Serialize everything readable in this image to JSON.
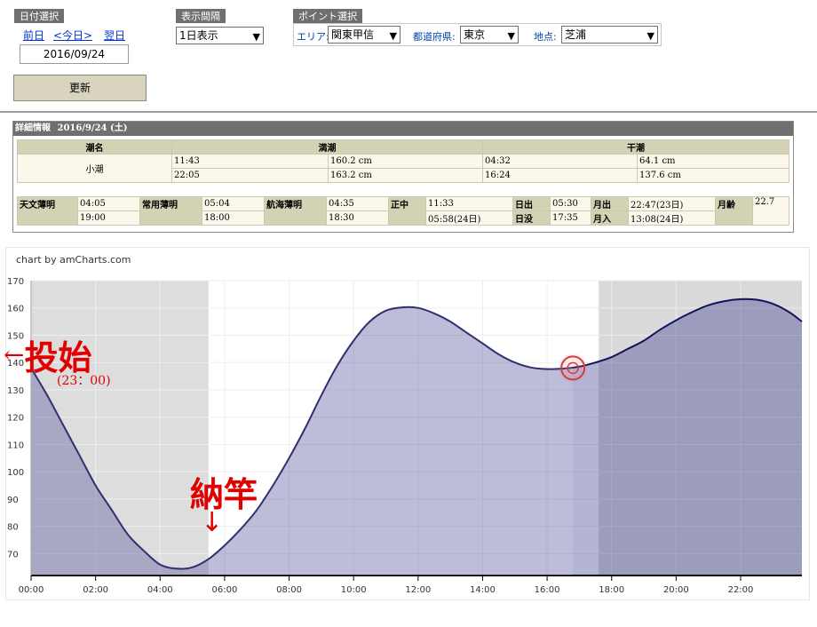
{
  "date_select": {
    "header": "日付選択",
    "prev": "前日",
    "today": "<今日>",
    "next": "翌日",
    "date_value": "2016/09/24"
  },
  "display_interval": {
    "header": "表示間隔",
    "selected": "1日表示"
  },
  "point_select": {
    "header": "ポイント選択",
    "area_label": "エリア:",
    "area_value": "関東甲信",
    "pref_label": "都道府県:",
    "pref_value": "東京",
    "spot_label": "地点:",
    "spot_value": "芝浦"
  },
  "update_button": "更新",
  "detail": {
    "header_title": "詳細情報",
    "header_date": "2016/9/24 (土)",
    "tide_name_header": "潮名",
    "high_header": "満潮",
    "low_header": "干潮",
    "tide_name": "小潮",
    "high": [
      {
        "time": "11:43",
        "height": "160.2 cm"
      },
      {
        "time": "22:05",
        "height": "163.2 cm"
      }
    ],
    "low": [
      {
        "time": "04:32",
        "height": "64.1 cm"
      },
      {
        "time": "16:24",
        "height": "137.6 cm"
      }
    ],
    "astro_label": "天文薄明",
    "astro_1": "04:05",
    "astro_2": "19:00",
    "civil_label": "常用薄明",
    "civil_1": "05:04",
    "civil_2": "18:00",
    "nautical_label": "航海薄明",
    "nautical_1": "04:35",
    "nautical_2": "18:30",
    "transit_label": "正中",
    "transit_1": "11:33",
    "transit_2": "05:58(24日)",
    "sunrise_label": "日出",
    "sunrise": "05:30",
    "sunset_label": "日没",
    "sunset": "17:35",
    "moonrise_label": "月出",
    "moonrise": "22:47(23日)",
    "moonset_label": "月入",
    "moonset": "13:08(24日)",
    "moonage_label": "月齢",
    "moonage": "22.7"
  },
  "annotations": {
    "start_text": "投始",
    "start_arrow": "←",
    "start_time": "(23：00)",
    "end_text": "納竿",
    "end_arrow": "↓"
  },
  "chart_data": {
    "type": "area",
    "credit": "chart by amCharts.com",
    "x_ticks": [
      "00:00",
      "02:00",
      "04:00",
      "06:00",
      "08:00",
      "10:00",
      "12:00",
      "14:00",
      "16:00",
      "18:00",
      "20:00",
      "22:00"
    ],
    "y_ticks": [
      70,
      80,
      90,
      100,
      110,
      120,
      130,
      140,
      150,
      160,
      170
    ],
    "ylim": [
      62,
      170
    ],
    "xlim_hours": [
      0,
      23.9
    ],
    "night_bands_hours": [
      [
        0,
        5.5
      ],
      [
        17.6,
        23.9
      ]
    ],
    "grid": true,
    "series": [
      {
        "x_hours": [
          0,
          0.5,
          1,
          1.5,
          2,
          2.5,
          3,
          3.5,
          4,
          4.5,
          5,
          5.5,
          6,
          6.5,
          7,
          7.5,
          8,
          8.5,
          9,
          9.5,
          10,
          10.5,
          11,
          11.5,
          12,
          12.5,
          13,
          13.5,
          14,
          14.5,
          15,
          15.5,
          16,
          16.5,
          17,
          17.5,
          18,
          18.5,
          19,
          19.5,
          20,
          20.5,
          21,
          21.5,
          22,
          22.5,
          23,
          23.5,
          23.9
        ],
        "values": [
          138,
          128,
          117,
          106,
          95,
          86,
          77,
          71,
          66,
          64.5,
          65,
          68,
          73,
          79,
          86,
          95,
          105,
          116,
          128,
          139,
          148,
          155,
          159,
          160.2,
          160,
          158,
          155,
          151,
          147,
          143,
          140,
          138.2,
          137.6,
          137.8,
          138.5,
          140,
          142,
          145,
          148,
          152,
          155.5,
          158.5,
          161,
          162.5,
          163.2,
          163,
          161.5,
          158.5,
          155
        ]
      }
    ],
    "marker_hours": 16.8,
    "marker_value": 138
  }
}
